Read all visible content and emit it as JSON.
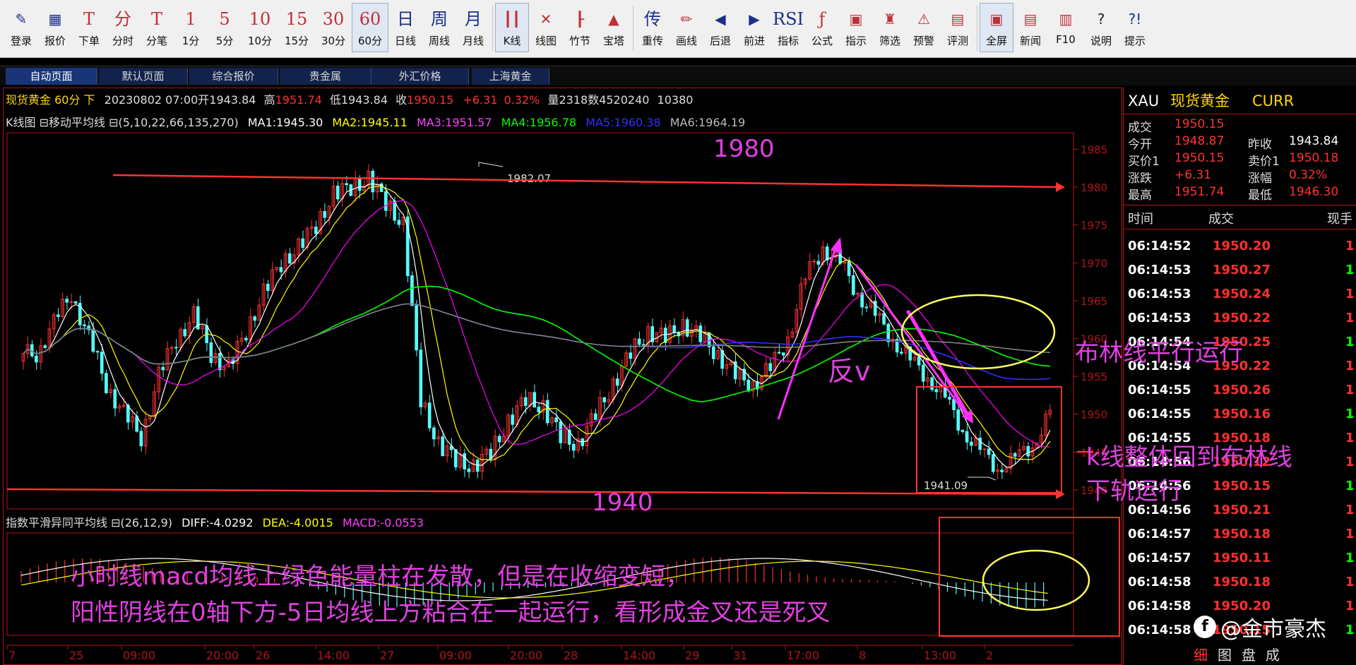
{
  "toolbar": [
    {
      "glyph": "✎",
      "label": "登录",
      "cls": "icon blue",
      "name": "login-button"
    },
    {
      "glyph": "▦",
      "label": "报价",
      "cls": "icon blue",
      "name": "quote-button"
    },
    {
      "glyph": "T",
      "label": "下单",
      "cls": "",
      "name": "order-button"
    },
    {
      "glyph": "分",
      "label": "分时",
      "cls": "",
      "name": "timeshare-button"
    },
    {
      "glyph": "T",
      "label": "分笔",
      "cls": "",
      "name": "tick-button"
    },
    {
      "glyph": "1",
      "label": "1分",
      "cls": "",
      "name": "period-1min-button"
    },
    {
      "glyph": "5",
      "label": "5分",
      "cls": "",
      "name": "period-5min-button"
    },
    {
      "glyph": "10",
      "label": "10分",
      "cls": "",
      "name": "period-10min-button"
    },
    {
      "glyph": "15",
      "label": "15分",
      "cls": "",
      "name": "period-15min-button"
    },
    {
      "glyph": "30",
      "label": "30分",
      "cls": "",
      "name": "period-30min-button"
    },
    {
      "glyph": "60",
      "label": "60分",
      "cls": "active",
      "name": "period-60min-button"
    },
    {
      "glyph": "日",
      "label": "日线",
      "cls": "blue",
      "name": "period-day-button"
    },
    {
      "glyph": "周",
      "label": "周线",
      "cls": "blue",
      "name": "period-week-button"
    },
    {
      "glyph": "月",
      "label": "月线",
      "cls": "blue",
      "name": "period-month-button"
    },
    {
      "glyph": "┃┃",
      "label": "K线",
      "cls": "icon active",
      "name": "kline-button"
    },
    {
      "glyph": "✕",
      "label": "线图",
      "cls": "icon",
      "name": "linechart-button"
    },
    {
      "glyph": "┠",
      "label": "竹节",
      "cls": "icon",
      "name": "bamboo-button"
    },
    {
      "glyph": "▲",
      "label": "宝塔",
      "cls": "icon",
      "name": "tower-button"
    },
    {
      "glyph": "传",
      "label": "重传",
      "cls": "blue",
      "name": "resend-button"
    },
    {
      "glyph": "✏",
      "label": "画线",
      "cls": "icon",
      "name": "draw-line-button"
    },
    {
      "glyph": "◀",
      "label": "后退",
      "cls": "icon blue",
      "name": "back-button"
    },
    {
      "glyph": "▶",
      "label": "前进",
      "cls": "icon blue",
      "name": "forward-button"
    },
    {
      "glyph": "RSI",
      "label": "指标",
      "cls": "blue",
      "name": "indicator-button"
    },
    {
      "glyph": "ƒ",
      "label": "公式",
      "cls": "",
      "name": "formula-button"
    },
    {
      "glyph": "▣",
      "label": "指示",
      "cls": "icon",
      "name": "indicate-button"
    },
    {
      "glyph": "♜",
      "label": "筛选",
      "cls": "icon",
      "name": "filter-button"
    },
    {
      "glyph": "⚠",
      "label": "预警",
      "cls": "icon",
      "name": "alert-button"
    },
    {
      "glyph": "▤",
      "label": "评测",
      "cls": "icon",
      "name": "evaluate-button"
    },
    {
      "glyph": "▣",
      "label": "全屏",
      "cls": "icon active",
      "name": "fullscreen-button"
    },
    {
      "glyph": "▤",
      "label": "新闻",
      "cls": "icon",
      "name": "news-button"
    },
    {
      "glyph": "▥",
      "label": "F10",
      "cls": "icon",
      "name": "f10-button"
    },
    {
      "glyph": "?",
      "label": "说明",
      "cls": "icon black",
      "name": "help-doc-button"
    },
    {
      "glyph": "?!",
      "label": "提示",
      "cls": "icon blue",
      "name": "tips-button"
    }
  ],
  "tabs": [
    "自动页面",
    "默认页面",
    "综合报价",
    "贵金属",
    "外汇价格",
    "上海黄金"
  ],
  "infobar": {
    "symbol": "现货黄金 60分 下",
    "date": "20230802 07:00",
    "open_label": "开",
    "open": "1943.84",
    "high_label": "高",
    "high": "1951.74",
    "low_label": "低",
    "low": "1943.84",
    "close_label": "收",
    "close": "1950.15",
    "change": "+6.31",
    "pct": "0.32%",
    "vol_label": "量",
    "vol": "2318",
    "amount": "数4520240",
    "extra": "10380"
  },
  "indicator_bar": {
    "name": "K线图 ⊟移动平均线 ⊟(5,10,22,66,135,270)",
    "ma1": "MA1:1945.30",
    "ma2": "MA2:1945.11",
    "ma3": "MA3:1951.57",
    "ma4": "MA4:1956.78",
    "ma5": "MA5:1960.38",
    "ma6": "MA6:1964.19"
  },
  "macd_bar": {
    "name": "指数平滑异同平均线 ⊟(26,12,9)",
    "diff": "DIFF:-4.0292",
    "dea": "DEA:-4.0015",
    "macd": "MACD:-0.0553"
  },
  "colors": {
    "up": "#ff3232",
    "down": "#54fcfc",
    "ma1": "#ffffff",
    "ma2": "#ffff00",
    "ma3": "#ff00ff",
    "ma4": "#00ff00",
    "ma5": "#3030ff",
    "ma6": "#808080",
    "annotation": "#e040e0",
    "frame": "#b0141c"
  },
  "chart_data": {
    "type": "candlestick",
    "y_axis_ticks": [
      1985,
      1980,
      1975,
      1970,
      1965,
      1960,
      1955,
      1950,
      1945,
      1940
    ],
    "ylim": [
      1938.5,
      1987
    ],
    "x_axis_labels": [
      "7",
      "25",
      "09:00",
      "20:00",
      "26",
      "14:00",
      "27",
      "09:00",
      "20:00",
      "28",
      "14:00",
      "29",
      "31",
      "17:00",
      "8",
      "13:00",
      "2"
    ],
    "high_label": "1982.07",
    "low_label": "1941.09",
    "close_path": [
      1958,
      1962,
      1966,
      1960,
      1954,
      1950,
      1947,
      1955,
      1960,
      1963,
      1958,
      1956,
      1961,
      1966,
      1970,
      1972,
      1975,
      1979,
      1980,
      1981,
      1978,
      1975,
      1952,
      1946,
      1944,
      1943,
      1945,
      1949,
      1952,
      1951,
      1947,
      1946,
      1950,
      1954,
      1958,
      1961,
      1960,
      1962,
      1960,
      1958,
      1955,
      1954,
      1956,
      1960,
      1968,
      1972,
      1970,
      1966,
      1963,
      1960,
      1957,
      1955,
      1952,
      1948,
      1945,
      1943,
      1944,
      1946,
      1950
    ]
  },
  "right_panel": {
    "code": "XAU",
    "name": "现货黄金",
    "market": "CURR",
    "last_label": "成交",
    "last": "1950.15",
    "open_label": "今开",
    "open": "1948.87",
    "prev_label": "昨收",
    "prev": "1943.84",
    "bid_label": "买价1",
    "bid": "1950.15",
    "ask_label": "卖价1",
    "ask": "1950.18",
    "chg_label": "涨跌",
    "chg": "+6.31",
    "amp_label": "涨幅",
    "amp": "0.32%",
    "high_label": "最高",
    "high": "1951.74",
    "low_label": "最低",
    "low": "1946.30",
    "col_time": "时间",
    "col_price": "成交",
    "col_vol": "现手",
    "ticks": [
      {
        "time": "06:14:52",
        "price": "1950.20",
        "vol": "1"
      },
      {
        "time": "06:14:53",
        "price": "1950.27",
        "vol": "1"
      },
      {
        "time": "06:14:53",
        "price": "1950.24",
        "vol": "1"
      },
      {
        "time": "06:14:53",
        "price": "1950.22",
        "vol": "1"
      },
      {
        "time": "06:14:54",
        "price": "1950.25",
        "vol": "1"
      },
      {
        "time": "06:14:54",
        "price": "1950.22",
        "vol": "1"
      },
      {
        "time": "06:14:55",
        "price": "1950.26",
        "vol": "1"
      },
      {
        "time": "06:14:55",
        "price": "1950.16",
        "vol": "1"
      },
      {
        "time": "06:14:55",
        "price": "1950.18",
        "vol": "1"
      },
      {
        "time": "06:14:56",
        "price": "1950.12",
        "vol": "1"
      },
      {
        "time": "06:14:56",
        "price": "1950.15",
        "vol": "1"
      },
      {
        "time": "06:14:56",
        "price": "1950.21",
        "vol": "1"
      },
      {
        "time": "06:14:57",
        "price": "1950.18",
        "vol": "1"
      },
      {
        "time": "06:14:57",
        "price": "1950.11",
        "vol": "1"
      },
      {
        "time": "06:14:58",
        "price": "1950.18",
        "vol": "1"
      },
      {
        "time": "06:14:58",
        "price": "1950.20",
        "vol": "1"
      },
      {
        "time": "06:14:58",
        "price": "1950.15",
        "vol": "1"
      }
    ],
    "bottom_tabs": [
      "细",
      "图",
      "盘",
      "成"
    ]
  },
  "annotations": {
    "level_1980": "1980",
    "level_1940": "1940",
    "reverse_v": "反v",
    "bollinger_flat": "布林线平行运行",
    "kline_back_1": "k线整体回到布林线",
    "kline_back_2": "下轨运行",
    "macd_note_1": "小时线macd均线上绿色能量柱在发散，但是在收缩变短，",
    "macd_note_2": "阳性阴线在0轴下方-5日均线上方粘合在一起运行，看形成金叉还是死叉",
    "watermark": "@金市豪杰"
  }
}
